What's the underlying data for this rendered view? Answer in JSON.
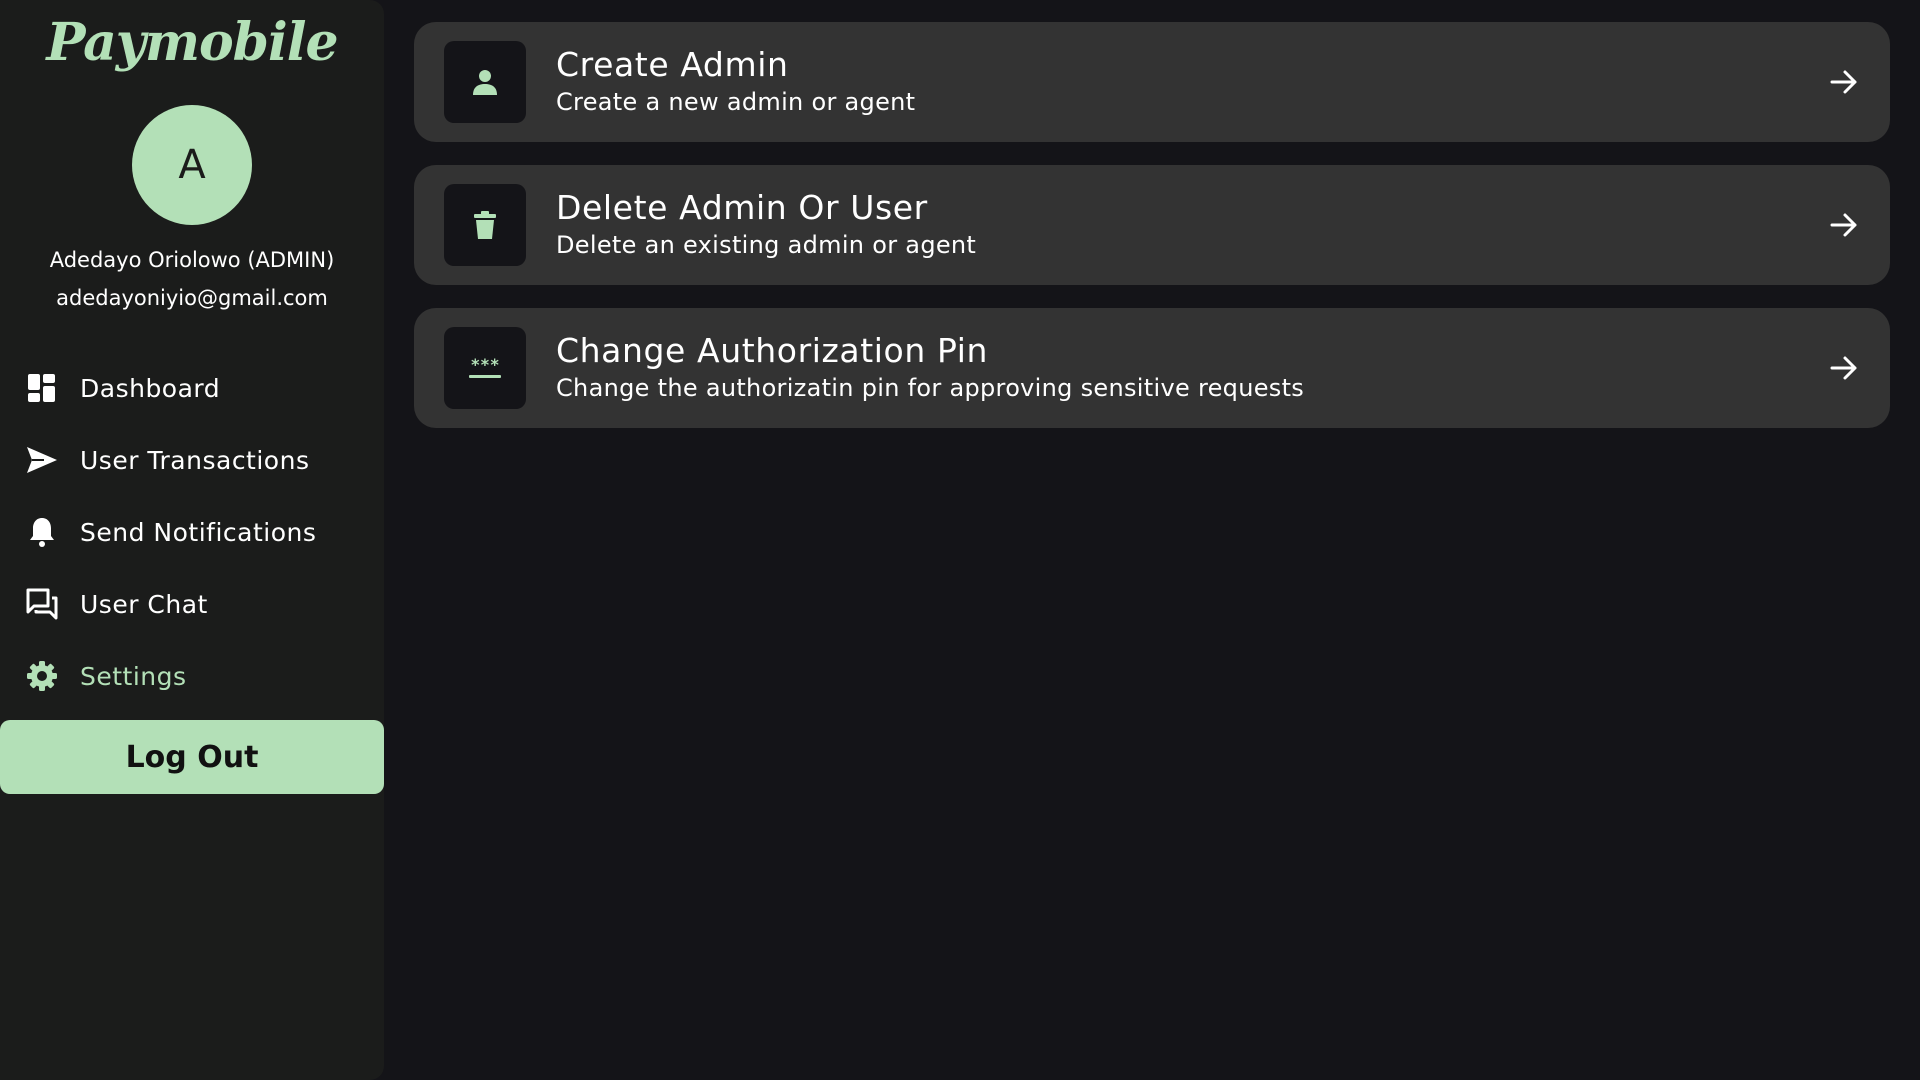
{
  "sidebar": {
    "logo": "Paymobile",
    "avatar_initial": "A",
    "user_name": "Adedayo Oriolowo (ADMIN)",
    "user_email": "adedayoniyio@gmail.com",
    "nav": [
      {
        "label": "Dashboard",
        "icon": "dashboard-icon"
      },
      {
        "label": "User Transactions",
        "icon": "send-icon"
      },
      {
        "label": "Send Notifications",
        "icon": "bell-icon"
      },
      {
        "label": "User Chat",
        "icon": "chat-icon"
      },
      {
        "label": "Settings",
        "icon": "gear-icon",
        "active": true
      }
    ],
    "logout_label": "Log Out"
  },
  "settings": {
    "cards": [
      {
        "title": "Create Admin",
        "subtitle": "Create a new admin or agent",
        "icon": "person-icon"
      },
      {
        "title": "Delete Admin Or User",
        "subtitle": "Delete an existing admin or agent",
        "icon": "trash-icon"
      },
      {
        "title": "Change Authorization Pin",
        "subtitle": "Change the authorizatin pin for approving sensitive requests",
        "icon": "password-icon"
      }
    ]
  },
  "colors": {
    "accent": "#b3e0b7",
    "background": "#141418",
    "sidebar": "#1b1c1b",
    "card": "#333333"
  }
}
